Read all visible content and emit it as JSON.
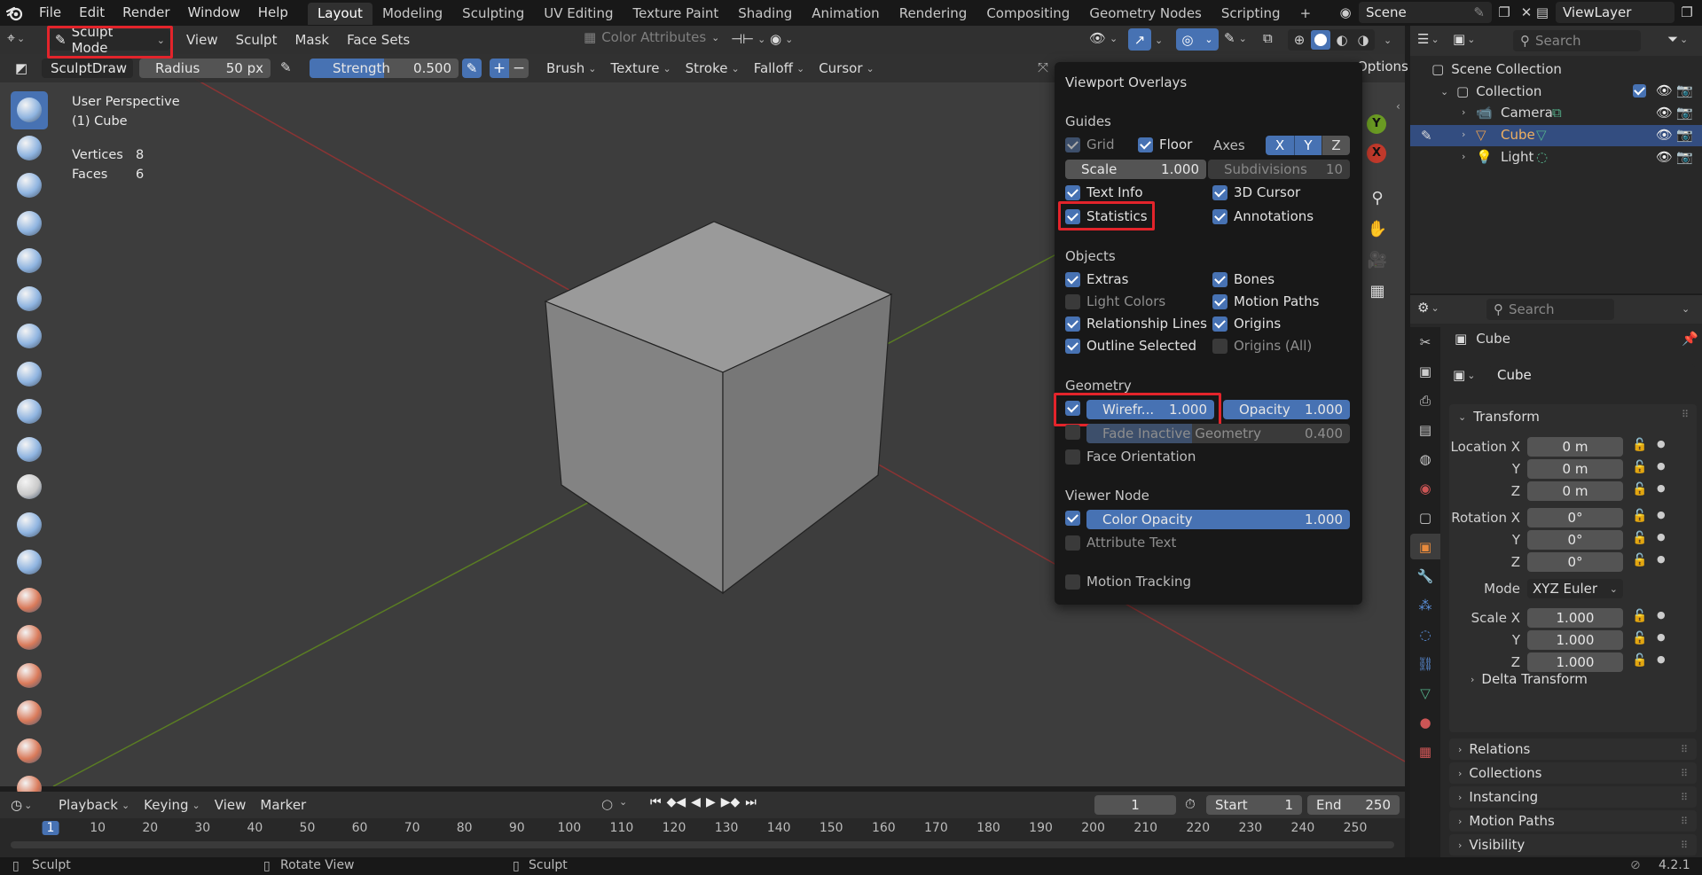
{
  "menu": {
    "items": [
      "File",
      "Edit",
      "Render",
      "Window",
      "Help"
    ]
  },
  "workspaces": [
    "Layout",
    "Modeling",
    "Sculpting",
    "UV Editing",
    "Texture Paint",
    "Shading",
    "Animation",
    "Rendering",
    "Compositing",
    "Geometry Nodes",
    "Scripting"
  ],
  "workspace_add": "+",
  "scene": {
    "name": "Scene",
    "view_layer": "ViewLayer"
  },
  "header": {
    "mode": "Sculpt Mode",
    "menus": [
      "View",
      "Sculpt",
      "Mask",
      "Face Sets"
    ],
    "color_attributes": "Color Attributes"
  },
  "toolsettings": {
    "brush_name": "SculptDraw",
    "radius_label": "Radius",
    "radius_value": "50 px",
    "strength_label": "Strength",
    "strength_value": "0.500",
    "plus": "+",
    "minus": "−",
    "dropdowns": [
      "Brush",
      "Texture",
      "Stroke",
      "Falloff",
      "Cursor"
    ],
    "options_label": "Options"
  },
  "viewport": {
    "perspective": "User Perspective",
    "object": "(1) Cube",
    "stats_vertices_label": "Vertices",
    "stats_vertices": "8",
    "stats_faces_label": "Faces",
    "stats_faces": "6"
  },
  "gizmo": {
    "y": "Y",
    "x": "X"
  },
  "overlays": {
    "title": "Viewport Overlays",
    "guides": {
      "title": "Guides",
      "grid": "Grid",
      "floor": "Floor",
      "axes": "Axes",
      "axis_x": "X",
      "axis_y": "Y",
      "axis_z": "Z",
      "scale_label": "Scale",
      "scale_value": "1.000",
      "subdiv_label": "Subdivisions",
      "subdiv_value": "10",
      "text_info": "Text Info",
      "cursor3d": "3D Cursor",
      "statistics": "Statistics",
      "annotations": "Annotations"
    },
    "objects": {
      "title": "Objects",
      "extras": "Extras",
      "bones": "Bones",
      "light_colors": "Light Colors",
      "motion_paths": "Motion Paths",
      "relationship_lines": "Relationship Lines",
      "origins": "Origins",
      "outline_selected": "Outline Selected",
      "origins_all": "Origins (All)"
    },
    "geometry": {
      "title": "Geometry",
      "wireframe_label": "Wirefr...",
      "wireframe_value": "1.000",
      "opacity_label": "Opacity",
      "opacity_value": "1.000",
      "fade_label": "Fade Inactive Geometry",
      "fade_value": "0.400",
      "face_orientation": "Face Orientation"
    },
    "viewer_node": {
      "title": "Viewer Node",
      "color_opacity_label": "Color Opacity",
      "color_opacity_value": "1.000",
      "attribute_text": "Attribute Text"
    },
    "motion_tracking": "Motion Tracking"
  },
  "outliner": {
    "search_placeholder": "Search",
    "scene_collection": "Scene Collection",
    "collection": "Collection",
    "items": [
      {
        "name": "Camera"
      },
      {
        "name": "Cube"
      },
      {
        "name": "Light"
      }
    ]
  },
  "properties": {
    "search_placeholder": "Search",
    "object_name": "Cube",
    "object_field": "Cube",
    "transform_title": "Transform",
    "location_label": "Location X",
    "loc_x": "0 m",
    "y_label": "Y",
    "loc_y": "0 m",
    "z_label": "Z",
    "loc_z": "0 m",
    "rotation_label": "Rotation X",
    "rot_x": "0°",
    "rot_y": "0°",
    "rot_z": "0°",
    "mode_label": "Mode",
    "mode_value": "XYZ Euler",
    "scale_label": "Scale X",
    "scale_x": "1.000",
    "scale_y": "1.000",
    "scale_z": "1.000",
    "sections": [
      "Delta Transform",
      "Relations",
      "Collections",
      "Instancing",
      "Motion Paths",
      "Visibility"
    ]
  },
  "timeline": {
    "menus": [
      "Playback",
      "Keying",
      "View",
      "Marker"
    ],
    "current_frame": "1",
    "start_label": "Start",
    "start": "1",
    "end_label": "End",
    "end": "250",
    "ruler": [
      "1",
      "10",
      "20",
      "30",
      "40",
      "50",
      "60",
      "70",
      "80",
      "90",
      "100",
      "110",
      "120",
      "130",
      "140",
      "150",
      "160",
      "170",
      "180",
      "190",
      "200",
      "210",
      "220",
      "230",
      "240",
      "250"
    ]
  },
  "statusbar": {
    "left": "Sculpt",
    "middle": "Rotate View",
    "right": "Sculpt",
    "version": "4.2.1"
  },
  "colors": {
    "accent": "#4772b3",
    "highlight": "#e3242b",
    "x_axis": "#c0392b",
    "y_axis": "#6a9a23"
  }
}
